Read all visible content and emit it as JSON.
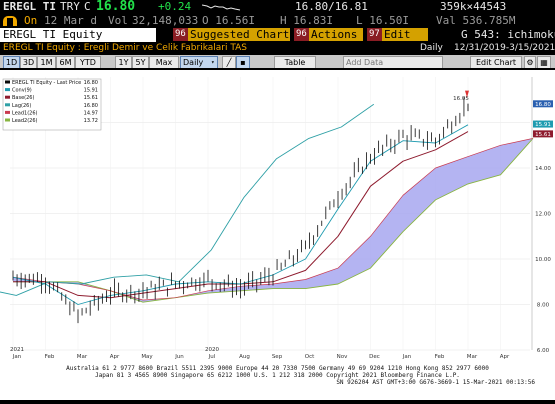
{
  "quote_bar": {
    "ticker": "EREGL TI",
    "currency": "TRY",
    "prefix": "C",
    "last": "16.80",
    "change": "+0.24",
    "bid_ask": "16.80/16.81",
    "size": "359k×44543"
  },
  "info_bar": {
    "on": "On",
    "date": "12 Mar d",
    "vol_label": "Vol",
    "volume": "32,148,033",
    "open": "O 16.56I",
    "high": "H 16.83I",
    "low": "L 16.50I",
    "val": "Val 536.785M"
  },
  "menu_bar": {
    "security": "EREGL TI Equity",
    "suggested_num": "96",
    "suggested": "Suggested Charts",
    "actions_num": "96",
    "actions": "Actions",
    "edit_num": "97",
    "edit": "Edit",
    "page": "G 543: ichimoku"
  },
  "title_bar": {
    "title": "EREGL TI Equity : Eregli Demir ve Celik Fabrikalari TAS",
    "frequency": "Daily",
    "range": "12/31/2019-3/15/2021"
  },
  "toolbar": {
    "periods": [
      "1D",
      "3D",
      "1M",
      "6M",
      "YTD",
      "1Y",
      "5Y",
      "Max"
    ],
    "frequency": "Daily",
    "table": "Table",
    "add_data": "Add Data",
    "edit_chart": "Edit Chart"
  },
  "footer": {
    "line1": "Australia 61 2 9777 8600 Brazil 5511 2395 9000 Europe 44 20 7330 7500 Germany 49 69 9204 1210 Hong Kong 852 2977 6000",
    "line2": "Japan 81 3 4565 8900   Singapore 65 6212 1000   U.S. 1 212 318 2000   Copyright 2021 Bloomberg Finance L.P.",
    "line3": "SN 926204 AST  GMT+3:00 G676-3669-1 15-Mar-2021 00:13:56"
  },
  "colors": {
    "price": "#0a0a0a",
    "conversion": "#1f9bb0",
    "base": "#8e1b2e",
    "lag": "#2fa0a6",
    "lead1": "#c93a4f",
    "lead2": "#88b541",
    "cloud": "#a7a7f0"
  },
  "chart_data": {
    "type": "line",
    "title": "EREGL TI Equity : Eregli Demir ve Celik Fabrikalari TAS",
    "ylim": [
      6.0,
      18.0
    ],
    "yticks": [
      6.0,
      8.0,
      10.0,
      12.0,
      14.0,
      16.0
    ],
    "x_tick_labels": [
      "Jan",
      "Feb",
      "Mar",
      "Apr",
      "May",
      "Jun",
      "Jul",
      "Aug",
      "Sep",
      "Oct",
      "Nov",
      "Dec",
      "Jan",
      "Feb",
      "Mar",
      "Apr"
    ],
    "year_labels": [
      {
        "label": "2020",
        "at": "Jul"
      },
      {
        "label": "2021",
        "at": "Jan"
      }
    ],
    "legend": [
      {
        "name": "EREGL TI Equity - Last Price",
        "value": 16.8
      },
      {
        "name": "Conv(9)",
        "value": 15.91
      },
      {
        "name": "Base(26)",
        "value": 15.61
      },
      {
        "name": "Lag(26)",
        "value": 16.8
      },
      {
        "name": "Lead1(26)",
        "value": 14.97
      },
      {
        "name": "Lead2(26)",
        "value": 13.72
      }
    ],
    "last_price_labels": [
      "16.80",
      "15.91",
      "15.61"
    ],
    "high_annotation": "16.05",
    "months": [
      "Jan 2020",
      "Feb 2020",
      "Mar 2020",
      "Apr 2020",
      "May 2020",
      "Jun 2020",
      "Jul 2020",
      "Aug 2020",
      "Sep 2020",
      "Oct 2020",
      "Nov 2020",
      "Dec 2020",
      "Jan 2021",
      "Feb 2021",
      "Mar 2021"
    ],
    "series": [
      {
        "name": "EREGL TI Equity - Last Price",
        "values": [
          9.2,
          9.1,
          7.5,
          8.5,
          8.6,
          8.9,
          9.1,
          8.7,
          9.3,
          10.5,
          12.8,
          14.5,
          15.4,
          15.2,
          16.8
        ]
      },
      {
        "name": "Conv(9)",
        "values": [
          9.2,
          8.9,
          8.0,
          8.4,
          8.6,
          8.9,
          9.0,
          8.9,
          9.3,
          10.0,
          12.2,
          14.3,
          15.2,
          15.1,
          15.9
        ]
      },
      {
        "name": "Base(26)",
        "values": [
          9.0,
          9.0,
          8.4,
          8.3,
          8.5,
          8.7,
          8.9,
          8.9,
          9.0,
          9.5,
          11.0,
          13.2,
          14.3,
          14.8,
          15.6
        ]
      },
      {
        "name": "Lag(26)",
        "values": [
          8.7,
          8.4,
          9.0,
          8.9,
          9.2,
          9.3,
          9.0,
          10.4,
          12.7,
          14.4,
          15.3,
          15.8,
          16.8
        ]
      },
      {
        "name": "Lead1(26)",
        "values": [
          9.2,
          9.0,
          8.9,
          8.6,
          8.2,
          8.3,
          8.6,
          8.8,
          8.9,
          9.1,
          9.6,
          11.0,
          12.8,
          14.0,
          14.5,
          15.0,
          15.3
        ]
      },
      {
        "name": "Lead2(26)",
        "values": [
          9.0,
          9.0,
          9.0,
          8.6,
          8.1,
          8.3,
          8.5,
          8.6,
          8.7,
          8.7,
          8.9,
          9.6,
          11.2,
          12.6,
          13.3,
          13.7,
          15.3
        ]
      }
    ]
  }
}
